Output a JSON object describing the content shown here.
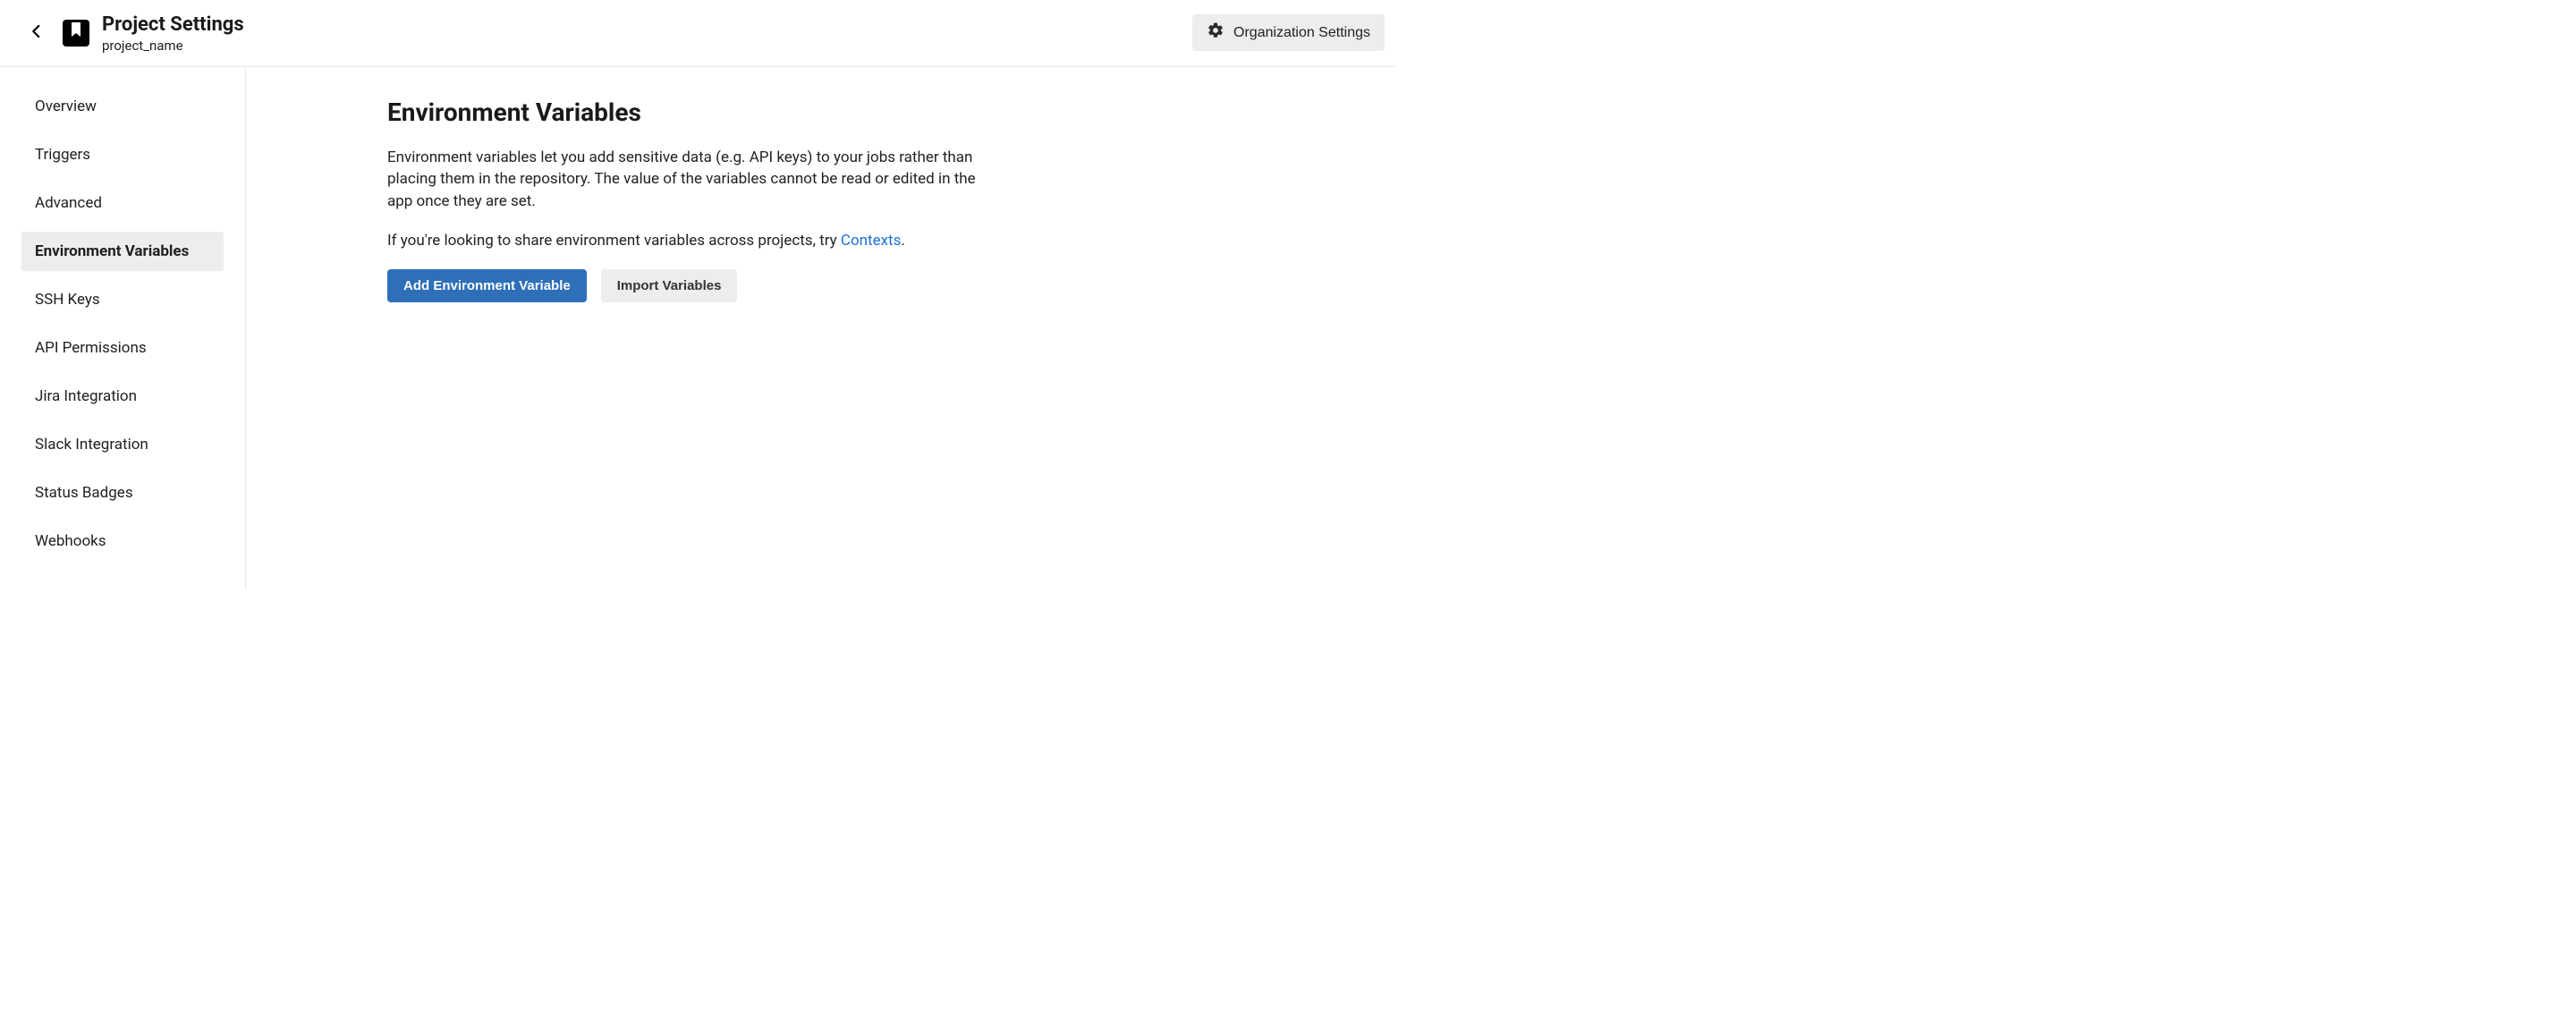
{
  "header": {
    "page_title": "Project Settings",
    "project_name": "project_name",
    "org_settings_label": "Organization Settings"
  },
  "sidebar": {
    "items": [
      {
        "label": "Overview",
        "active": false
      },
      {
        "label": "Triggers",
        "active": false
      },
      {
        "label": "Advanced",
        "active": false
      },
      {
        "label": "Environment Variables",
        "active": true
      },
      {
        "label": "SSH Keys",
        "active": false
      },
      {
        "label": "API Permissions",
        "active": false
      },
      {
        "label": "Jira Integration",
        "active": false
      },
      {
        "label": "Slack Integration",
        "active": false
      },
      {
        "label": "Status Badges",
        "active": false
      },
      {
        "label": "Webhooks",
        "active": false
      }
    ]
  },
  "main": {
    "title": "Environment Variables",
    "description": "Environment variables let you add sensitive data (e.g. API keys) to your jobs rather than placing them in the repository. The value of the variables cannot be read or edited in the app once they are set.",
    "hint_prefix": "If you're looking to share environment variables across projects, try ",
    "hint_link": "Contexts",
    "hint_suffix": ".",
    "add_button": "Add Environment Variable",
    "import_button": "Import Variables"
  }
}
